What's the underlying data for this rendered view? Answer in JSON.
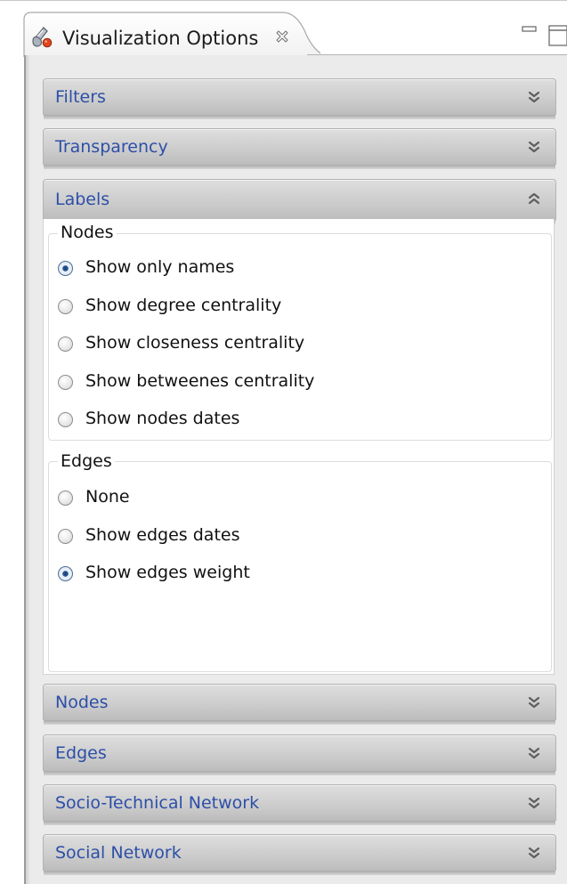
{
  "view": {
    "title": "Visualization Options",
    "icon": "palette-icon",
    "close_icon": "close-icon",
    "minimize_icon": "minimize-icon",
    "maximize_icon": "maximize-icon"
  },
  "sections": {
    "filters": {
      "title": "Filters",
      "expanded": false
    },
    "transparency": {
      "title": "Transparency",
      "expanded": false
    },
    "labels": {
      "title": "Labels",
      "expanded": true
    },
    "nodes": {
      "title": "Nodes",
      "expanded": false
    },
    "edges": {
      "title": "Edges",
      "expanded": false
    },
    "socio_technical": {
      "title": "Socio-Technical Network",
      "expanded": false
    },
    "social_network": {
      "title": "Social Network",
      "expanded": false
    }
  },
  "labels_panel": {
    "nodes_group": {
      "title": "Nodes",
      "options": [
        {
          "label": "Show only names",
          "checked": true
        },
        {
          "label": "Show degree centrality",
          "checked": false
        },
        {
          "label": "Show closeness centrality",
          "checked": false
        },
        {
          "label": "Show betweenes centrality",
          "checked": false
        },
        {
          "label": "Show nodes dates",
          "checked": false
        }
      ]
    },
    "edges_group": {
      "title": "Edges",
      "options": [
        {
          "label": "None",
          "checked": false
        },
        {
          "label": "Show edges dates",
          "checked": false
        },
        {
          "label": "Show edges weight",
          "checked": true
        }
      ]
    }
  },
  "colors": {
    "section_title": "#2d4fa8",
    "header_gradient_top": "#dedede",
    "header_gradient_bottom": "#bcbcbc",
    "panel_background": "#ebebeb",
    "radio_checked": "#1d3f70"
  }
}
